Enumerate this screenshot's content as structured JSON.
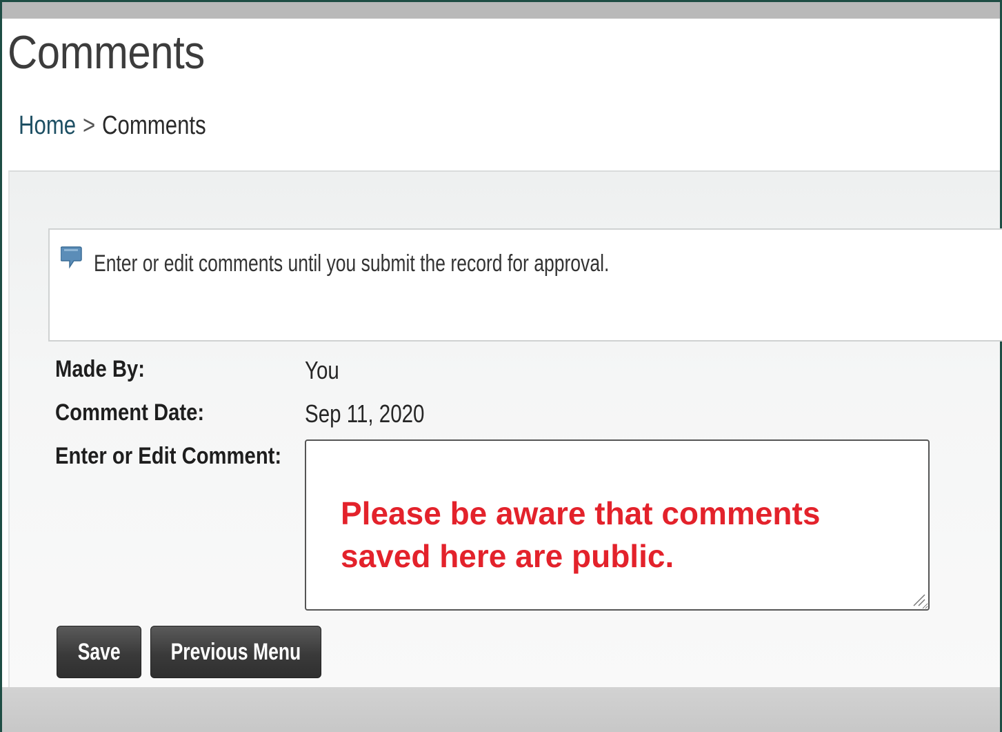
{
  "header": {
    "title": "Comments"
  },
  "breadcrumb": {
    "home": "Home",
    "separator": ">",
    "current": "Comments"
  },
  "info_box": {
    "icon": "speech-bubble-icon",
    "message": "Enter or edit comments until you submit the record for approval."
  },
  "form": {
    "made_by_label": "Made By:",
    "made_by_value": "You",
    "comment_date_label": "Comment Date:",
    "comment_date_value": "Sep 11, 2020",
    "comment_label": "Enter or Edit Comment:",
    "comment_value": "Please be aware that comments\nsaved here are public."
  },
  "buttons": {
    "save_label": "Save",
    "previous_menu_label": "Previous Menu"
  },
  "colors": {
    "frame": "#1e4d44",
    "notice_text": "#e3222b",
    "button": "#3a3a3a"
  }
}
